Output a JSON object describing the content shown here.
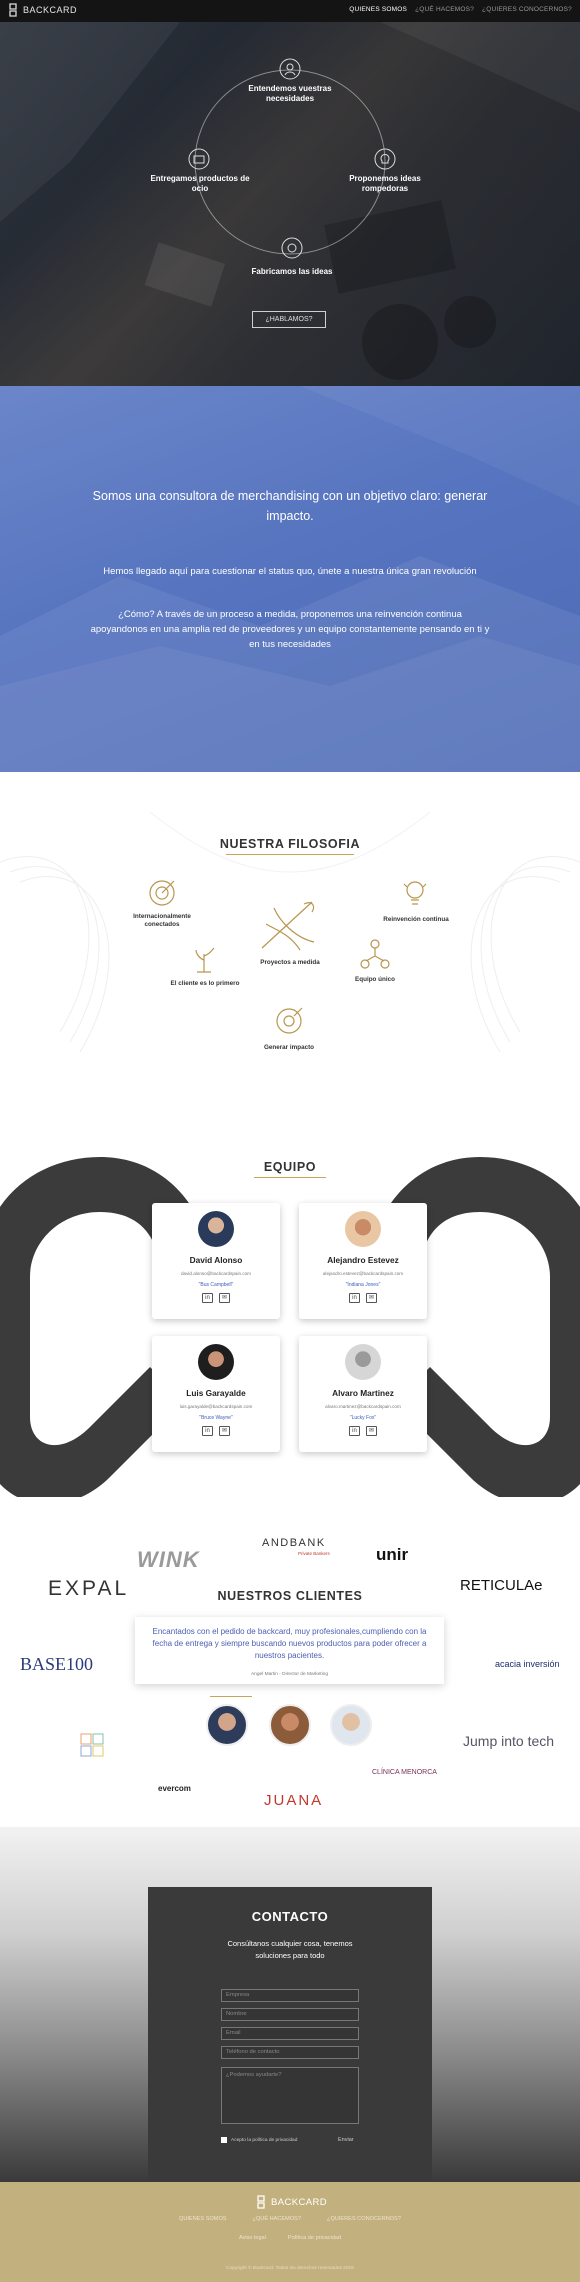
{
  "nav": {
    "brand": "BACKCARD",
    "links": [
      {
        "label": "QUIENES SOMOS",
        "active": true
      },
      {
        "label": "¿QUÉ HACEMOS?",
        "active": false
      },
      {
        "label": "¿QUIERES CONOCERNOS?",
        "active": false
      }
    ]
  },
  "hero": {
    "steps": [
      "Entendemos vuestras necesidades",
      "Entregamos productos de ocio",
      "Proponemos ideas rompedoras",
      "Fabricamos las ideas"
    ],
    "button": "¿HABLAMOS?"
  },
  "about": {
    "headline": "Somos una consultora de merchandising con un objetivo claro: generar impacto.",
    "paragraph1": "Hemos llegado aquí para cuestionar el status quo, únete a nuestra única gran revolución",
    "paragraph2": "¿Cómo? A través de un proceso a medida, proponemos una reinvención continua apoyandonos en una amplia red de proveedores y un equipo constantemente pensando en ti y en tus necesidades"
  },
  "filosofia": {
    "title": "NUESTRA FILOSOFIA",
    "items": [
      "Internacionalmente conectados",
      "Proyectos a medida",
      "Reinvención continua",
      "El cliente es lo primero",
      "Equipo único",
      "Generar impacto"
    ]
  },
  "equipo": {
    "title": "EQUIPO",
    "members": [
      {
        "name": "David Alonso",
        "email": "david.alonso@backcardspain.com",
        "nickname": "\"Bus Campbell\""
      },
      {
        "name": "Alejandro Estevez",
        "email": "alejandro.estevez@backcardspain.com",
        "nickname": "\"Indiana Jones\""
      },
      {
        "name": "Luis Garayalde",
        "email": "luis.garayalde@backcardspain.com",
        "nickname": "\"Bruce Wayne\""
      },
      {
        "name": "Alvaro Martinez",
        "email": "alvaro.martinez@backcardspain.com",
        "nickname": "\"Lucky Fox\""
      }
    ],
    "icons": [
      "linkedin-icon",
      "mail-icon"
    ]
  },
  "clientes": {
    "title": "NUESTROS CLIENTES",
    "logos": [
      "WINK",
      "ANDBANK",
      "Private Bankers",
      "unir",
      "EXPAL",
      "RETICULAe",
      "BASE100",
      "acacia inversión",
      "Jump into tech",
      "evercom",
      "CLÍNICA MENORCA",
      "JUANA"
    ],
    "quote": "Encantados con el pedido de backcard, muy profesionales,cumpliendo con la fecha de entrega y siempre buscando nuevos productos para poder ofrecer a nuestros pacientes.",
    "quote_author": "Angel Martin - Director de Marketing"
  },
  "contacto": {
    "title": "CONTACTO",
    "subtitle": "Consúltanos cualquier cosa, tenemos soluciones para todo",
    "fields": [
      "Empresa",
      "Nombre",
      "Email",
      "Teléfono de contacto"
    ],
    "message_placeholder": "¿Podemos ayudarte?",
    "privacy": "Acepto la política de privacidad",
    "send": "Enviar"
  },
  "footer": {
    "brand": "BACKCARD",
    "links": [
      "QUIENES SOMOS",
      "¿QUÉ HACEMOS?",
      "¿QUIERES CONOCERNOS?"
    ],
    "links2": [
      "Aviso legal",
      "Política de privacidad"
    ],
    "copyright": "Copyright © Backcard. Todos los derechos reservados 2019"
  },
  "colors": {
    "blue": "#5674bf",
    "gold": "#b8964e",
    "footer": "#c2b07f",
    "nav": "#141414"
  }
}
